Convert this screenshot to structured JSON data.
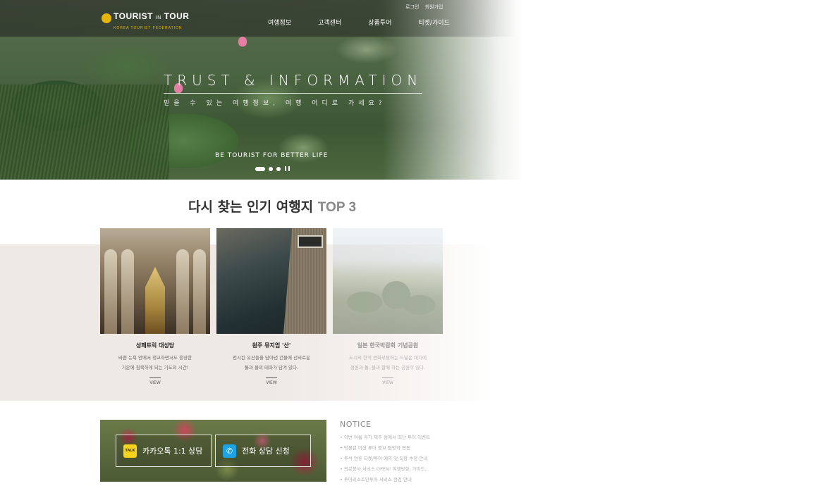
{
  "header": {
    "logo": {
      "main": "TOURIST",
      "mid": "IN",
      "end": "TOUR",
      "sub": "KOREA TOURIST FEDERATION"
    },
    "util_links": [
      "로그인",
      "회원가입"
    ],
    "nav": [
      "여행정보",
      "고객센터",
      "상품투어",
      "티켓/가이드"
    ]
  },
  "hero": {
    "title": "TRUST & INFORMATION",
    "subtitle": "믿을 수 있는 여행정보, 여행 어디로 가세요?",
    "tagline": "BE TOURIST FOR BETTER LIFE",
    "slides_total": 3,
    "slide_active": 1
  },
  "top3": {
    "title_prefix": "다시 찾는 인기 여행지",
    "title_highlight": "TOP 3",
    "cards": [
      {
        "title": "성패트릭 대성당",
        "desc1": "바쁜 뉴욕 안에서 청교하면서도 웅장한",
        "desc2": "기운에 침묵하게 되는 기도의 시간!",
        "view": "VIEW"
      },
      {
        "title": "원주 뮤지엄 '산'",
        "desc1": "전시된 유산들을 담아낸 건물에 신비로운",
        "desc2": "돌과 물의 테마가 담겨 있다.",
        "view": "VIEW"
      },
      {
        "title": "일본 한국박람회 기념공원",
        "desc1": "도시의 한적 변화무쌍하는 드넓은 대지에",
        "desc2": "정원과 돌, 물과 함께 하는 공원이 있다.",
        "view": "VIEW"
      }
    ]
  },
  "consult": {
    "kakao_label": "카카오톡 1:1 상담",
    "kakao_icon_text": "TALK",
    "phone_label": "전화 상담 신청",
    "phone_icon_text": "✆"
  },
  "notice": {
    "title": "NOTICE",
    "items": [
      "이번 여름 휴가 제주 섬에서 떠난 투어 이벤트",
      "박물관 미션 투어 중요 탐방자 변동",
      "추석 연휴 티켓/투어 예약 및 직항 수정 안내",
      "의료봉사 서비스 OPEN! 여행방항, 가이드...",
      "투어리스트인투어 서비스 점검 안내"
    ]
  }
}
